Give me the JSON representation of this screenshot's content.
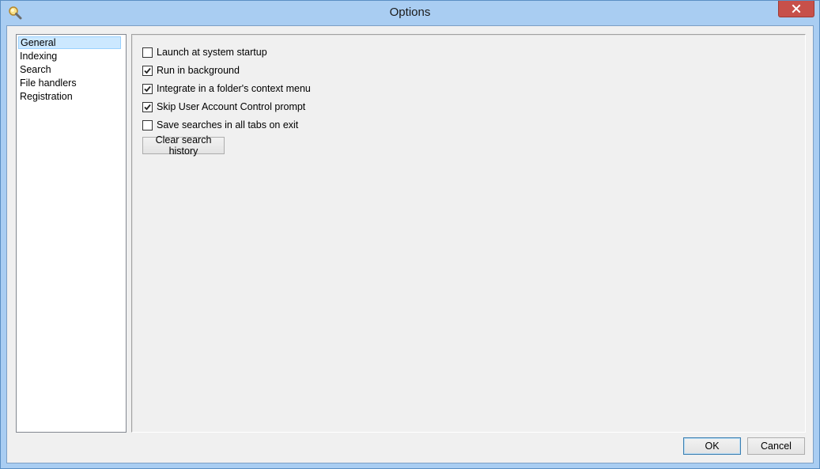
{
  "window": {
    "title": "Options"
  },
  "nav": {
    "items": [
      {
        "label": "General",
        "selected": true
      },
      {
        "label": "Indexing",
        "selected": false
      },
      {
        "label": "Search",
        "selected": false
      },
      {
        "label": "File handlers",
        "selected": false
      },
      {
        "label": "Registration",
        "selected": false
      }
    ]
  },
  "general": {
    "options": [
      {
        "label": "Launch at system startup",
        "checked": false
      },
      {
        "label": "Run in background",
        "checked": true
      },
      {
        "label": "Integrate in a folder's context menu",
        "checked": true
      },
      {
        "label": "Skip User Account Control prompt",
        "checked": true
      },
      {
        "label": "Save searches in all tabs on exit",
        "checked": false
      }
    ],
    "clear_history_label": "Clear search history"
  },
  "footer": {
    "ok_label": "OK",
    "cancel_label": "Cancel"
  },
  "icons": {
    "app": "magnifier-icon",
    "close": "close-icon",
    "check": "checkmark-icon"
  },
  "colors": {
    "frame": "#a9cdf2",
    "close_button": "#c7504a",
    "selection": "#cce8ff"
  }
}
